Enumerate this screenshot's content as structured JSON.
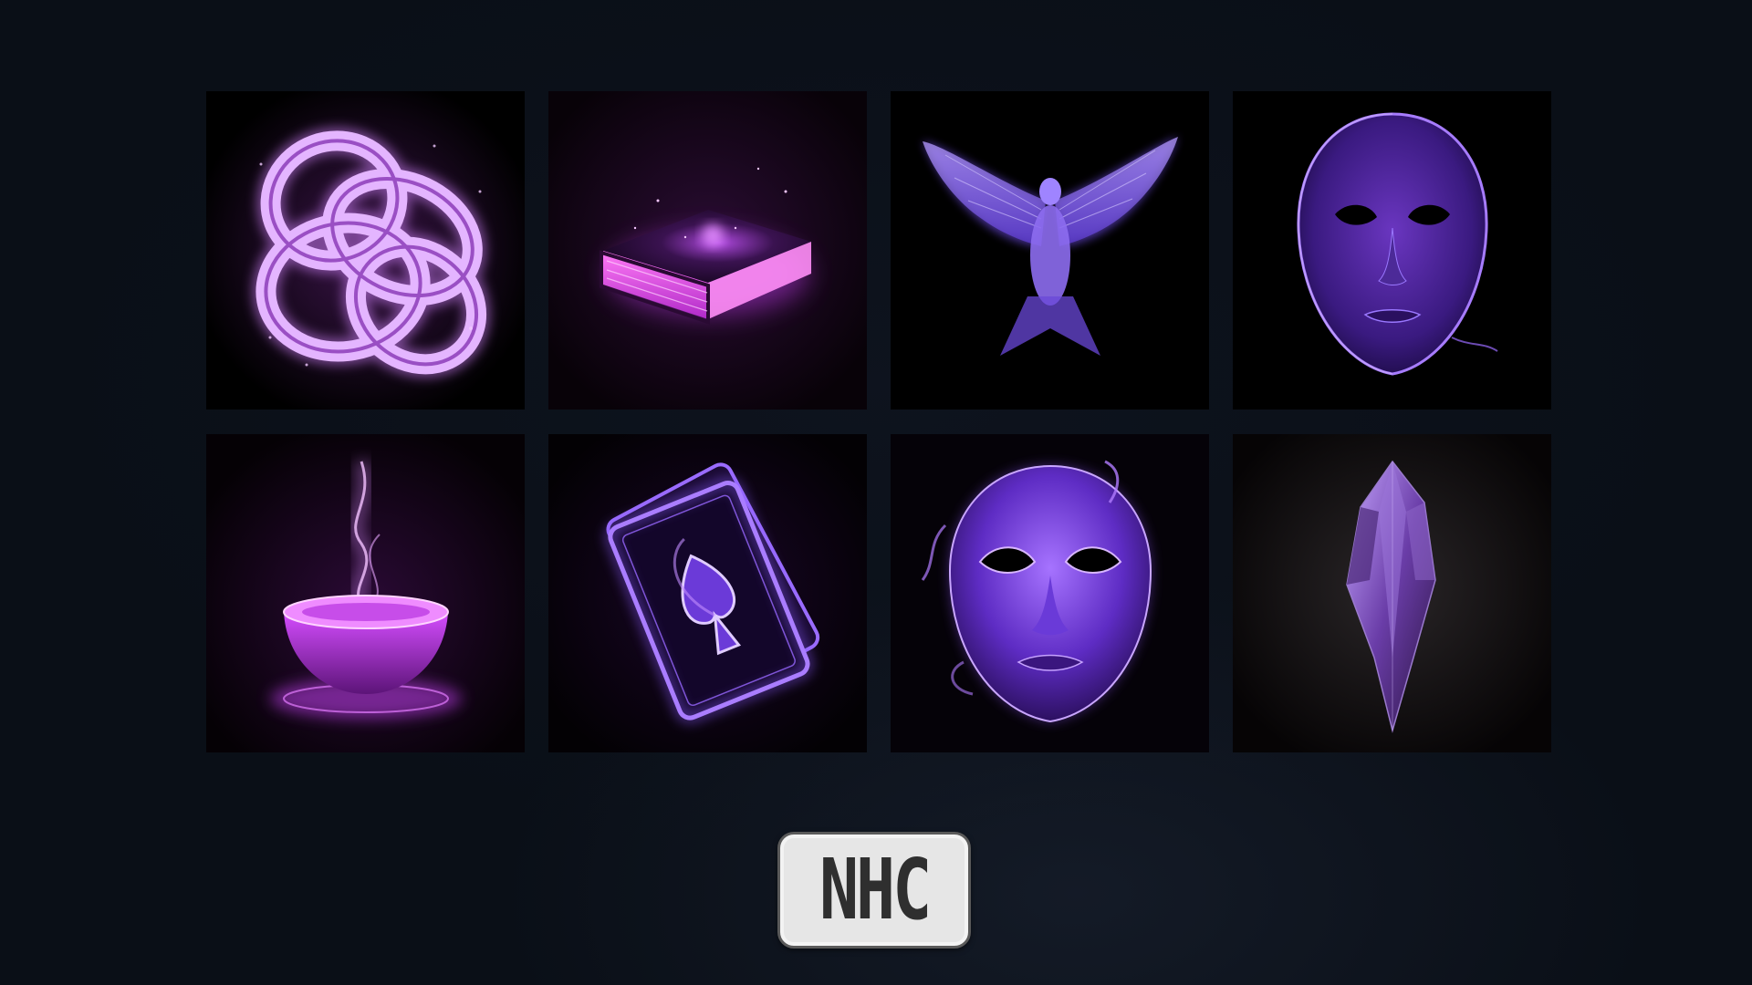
{
  "badge": {
    "label": "NHC"
  },
  "tiles": [
    {
      "icon": "knot-icon",
      "glow": "#d79cff"
    },
    {
      "icon": "book-icon",
      "glow": "#e060ff"
    },
    {
      "icon": "dove-icon",
      "glow": "#9b6bff"
    },
    {
      "icon": "face-mask-icon",
      "glow": "#7a3cff"
    },
    {
      "icon": "potion-bowl-icon",
      "glow": "#d24dff"
    },
    {
      "icon": "playing-card-icon",
      "glow": "#a45cff"
    },
    {
      "icon": "theater-mask-icon",
      "glow": "#9a4dff"
    },
    {
      "icon": "crystal-icon",
      "glow": "#7a4fb8"
    }
  ],
  "colors": {
    "page_background": "#0a0f17",
    "tile_background": "#000000",
    "badge_background": "#e6e6e6",
    "badge_text": "#2f2f2f"
  }
}
